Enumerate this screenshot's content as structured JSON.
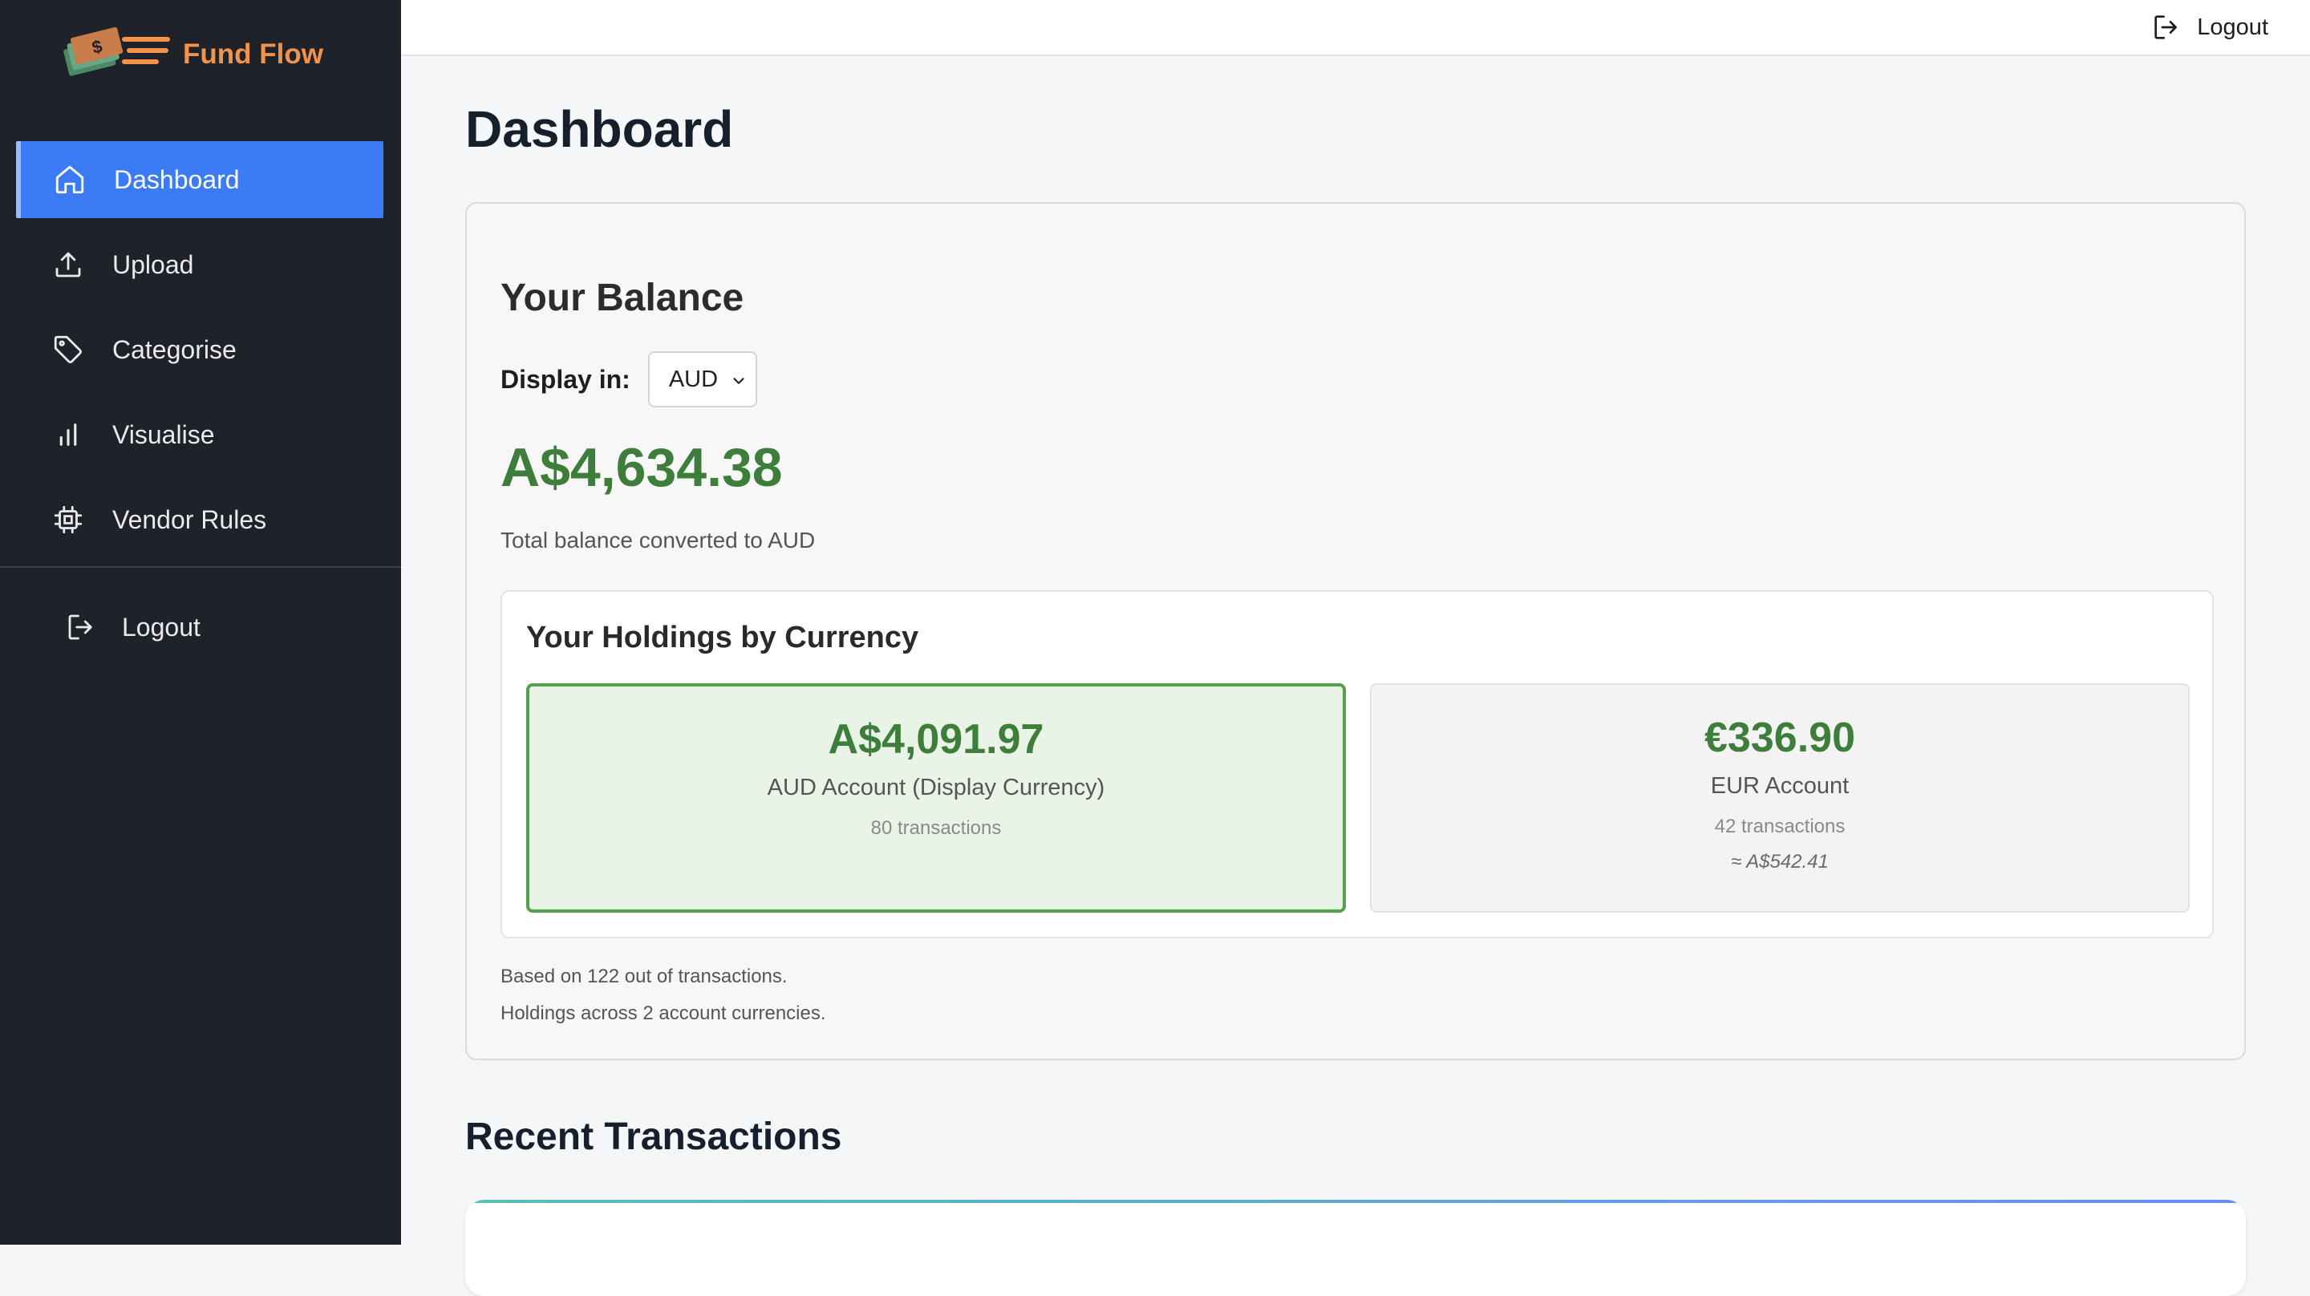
{
  "app": {
    "name": "Fund Flow"
  },
  "sidebar": {
    "items": [
      {
        "label": "Dashboard",
        "icon": "home-icon",
        "active": true
      },
      {
        "label": "Upload",
        "icon": "upload-icon"
      },
      {
        "label": "Categorise",
        "icon": "tag-icon"
      },
      {
        "label": "Visualise",
        "icon": "bar-chart-icon"
      },
      {
        "label": "Vendor Rules",
        "icon": "chip-icon"
      }
    ],
    "logout_label": "Logout"
  },
  "topbar": {
    "logout_label": "Logout"
  },
  "page": {
    "title": "Dashboard"
  },
  "balance": {
    "title": "Your Balance",
    "display_label": "Display in:",
    "display_currency": "AUD",
    "total": "A$4,634.38",
    "total_note": "Total balance converted to AUD",
    "holdings_title": "Your Holdings by Currency",
    "holdings": [
      {
        "amount": "A$4,091.97",
        "label": "AUD Account (Display Currency)",
        "count": "80 transactions"
      },
      {
        "amount": "€336.90",
        "label": "EUR Account",
        "count": "42 transactions",
        "approx": "≈ A$542.41"
      }
    ],
    "footnote_1": "Based on 122 out of transactions.",
    "footnote_2": "Holdings across 2 account currencies."
  },
  "recent": {
    "title": "Recent Transactions"
  },
  "colors": {
    "sidebar_bg": "#1f2228",
    "accent": "#3b7bf6",
    "brand": "#f1934a",
    "positive": "#3d7e3a"
  }
}
